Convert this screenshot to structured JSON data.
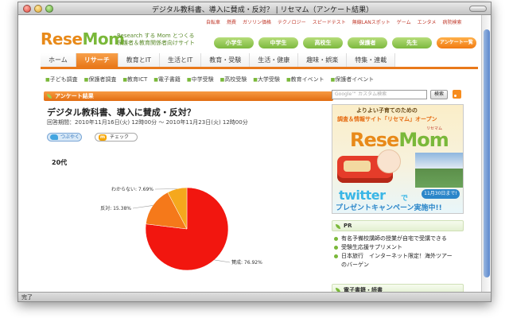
{
  "window": {
    "title": "デジタル教科書、導入に賛成・反対？ | リセマム（アンケート結果）"
  },
  "status": {
    "text": "完了"
  },
  "toplinks": [
    "自転車",
    "燃費",
    "ガソリン価格",
    "テクノロジー",
    "スピードテスト",
    "無線LANスポット",
    "ゲーム",
    "エンタメ",
    "病院検索"
  ],
  "logo": {
    "part1": "Rese",
    "part2": "Mom",
    "ruby": "リセマム"
  },
  "tagline": {
    "line1": "Research する Mom とつくる",
    "line2": "保護者＆教育関係者向けサイト"
  },
  "audience_buttons": [
    "小学生",
    "中学生",
    "高校生",
    "保護者",
    "先生"
  ],
  "survey_list_button": "アンケート一覧",
  "nav": {
    "tabs": [
      "ホーム",
      "リサーチ",
      "教育とIT",
      "生活とIT",
      "教育・受験",
      "生活・健康",
      "趣味・娯楽",
      "特集・連載"
    ],
    "active": "リサーチ"
  },
  "subnav": [
    "子ども調査",
    "保護者調査",
    "教育ICT",
    "電子書籍",
    "中学受験",
    "高校受験",
    "大学受験",
    "教育イベント",
    "保護者イベント"
  ],
  "section": {
    "title": "アンケート結果"
  },
  "article": {
    "headline": "デジタル教科書、導入に賛成・反対？",
    "period": "回答期間：2010年11月16日(火) 12時00分 〜 2010年11月23日(火) 12時00分",
    "share_buttons": [
      "つぶやく",
      "チェック"
    ]
  },
  "chart_data": {
    "type": "pie",
    "title": "20代",
    "slices": [
      {
        "label": "賛成",
        "value": 76.92,
        "display": "賛成: 76.92%",
        "color": "#f2160f"
      },
      {
        "label": "反対",
        "value": 15.38,
        "display": "反対: 15.38%",
        "color": "#f5791a"
      },
      {
        "label": "わからない",
        "value": 7.69,
        "display": "わからない: 7.69%",
        "color": "#f5a81d"
      }
    ]
  },
  "sidebar": {
    "search": {
      "placeholder": "Google™ カスタム検索",
      "button": "検索"
    },
    "ad": {
      "line1": "よりよい子育てのための",
      "line2": "調査＆情報サイト「リセマム」オープン",
      "twitter": "twitter",
      "de": "で",
      "deadline": "11月30日まで!",
      "campaign": "プレゼントキャンペーン実施中!!"
    },
    "pr": {
      "title": "PR",
      "items": [
        "有名予備校講師の授業が自宅で受講できる",
        "受験生応援サプリメント",
        "日本旅行　インターネット限定！海外ツアーのバーゲン"
      ]
    },
    "next_section": {
      "title": "電子書籍・読書"
    }
  }
}
